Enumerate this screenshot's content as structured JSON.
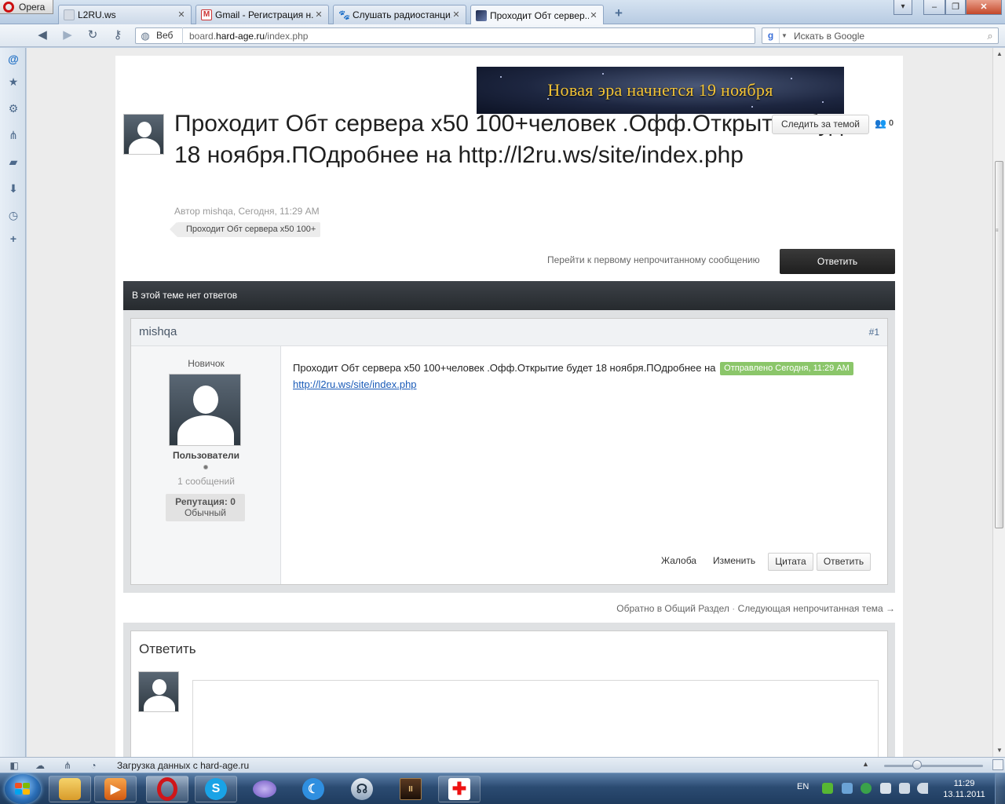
{
  "browser": {
    "menu_label": "Opera",
    "tabs": [
      {
        "label": "L2RU.ws"
      },
      {
        "label": "Gmail - Регистрация н..."
      },
      {
        "label": "Слушать радиостанци..."
      },
      {
        "label": "Проходит Обт сервер..."
      }
    ],
    "address": {
      "scheme_label": "Веб",
      "url_prefix": "board.",
      "url_domain": "hard-age.ru",
      "url_path": "/index.php"
    },
    "search_placeholder": "Искать в Google"
  },
  "page": {
    "banner_text": "Новая эра начнется 19 ноября",
    "topic": {
      "title": "Проходит Обт сервера x50 100+человек .Офф.Открытие будет 18 ноября.ПОдробнее на http://l2ru.ws/site/index.php",
      "follow_label": "Следить за темой",
      "follower_count": "0",
      "meta": "Автор mishqa, Сегодня, 11:29 AM",
      "tag": "Проходит Обт сервера x50 100+"
    },
    "first_unread_label": "Перейти к первому непрочитанному сообщению",
    "reply_button_label": "Ответить",
    "thread_bar_label": "В этой теме нет ответов",
    "post": {
      "author": "mishqa",
      "number": "#1",
      "rank": "Новичок",
      "group": "Пользователи",
      "post_count": "1 сообщений",
      "reputation_label": "Репутация: 0",
      "reputation_level": "Обычный",
      "body_text": "Проходит Обт сервера x50 100+человек .Офф.Открытие будет 18 ноября.ПОдробнее на",
      "body_link": "http://l2ru.ws/site/index.php",
      "sent_badge": "Отправлено Сегодня, 11:29 AM",
      "actions": {
        "report": "Жалоба",
        "edit": "Изменить",
        "quote": "Цитата",
        "reply": "Ответить"
      }
    },
    "bottom_nav": {
      "back": "Обратно в Общий Раздел",
      "separator": "·",
      "next": "Следующая непрочитанная тема →"
    },
    "reply_box": {
      "title": "Ответить"
    }
  },
  "statusbar": {
    "text": "Загрузка данных с hard-age.ru"
  },
  "taskbar": {
    "lang": "EN",
    "time": "11:29",
    "date": "13.11.2011"
  },
  "colors": {
    "accent_dark": "#262a2e",
    "badge_green": "#8bc66a",
    "link": "#1a5bb8"
  }
}
